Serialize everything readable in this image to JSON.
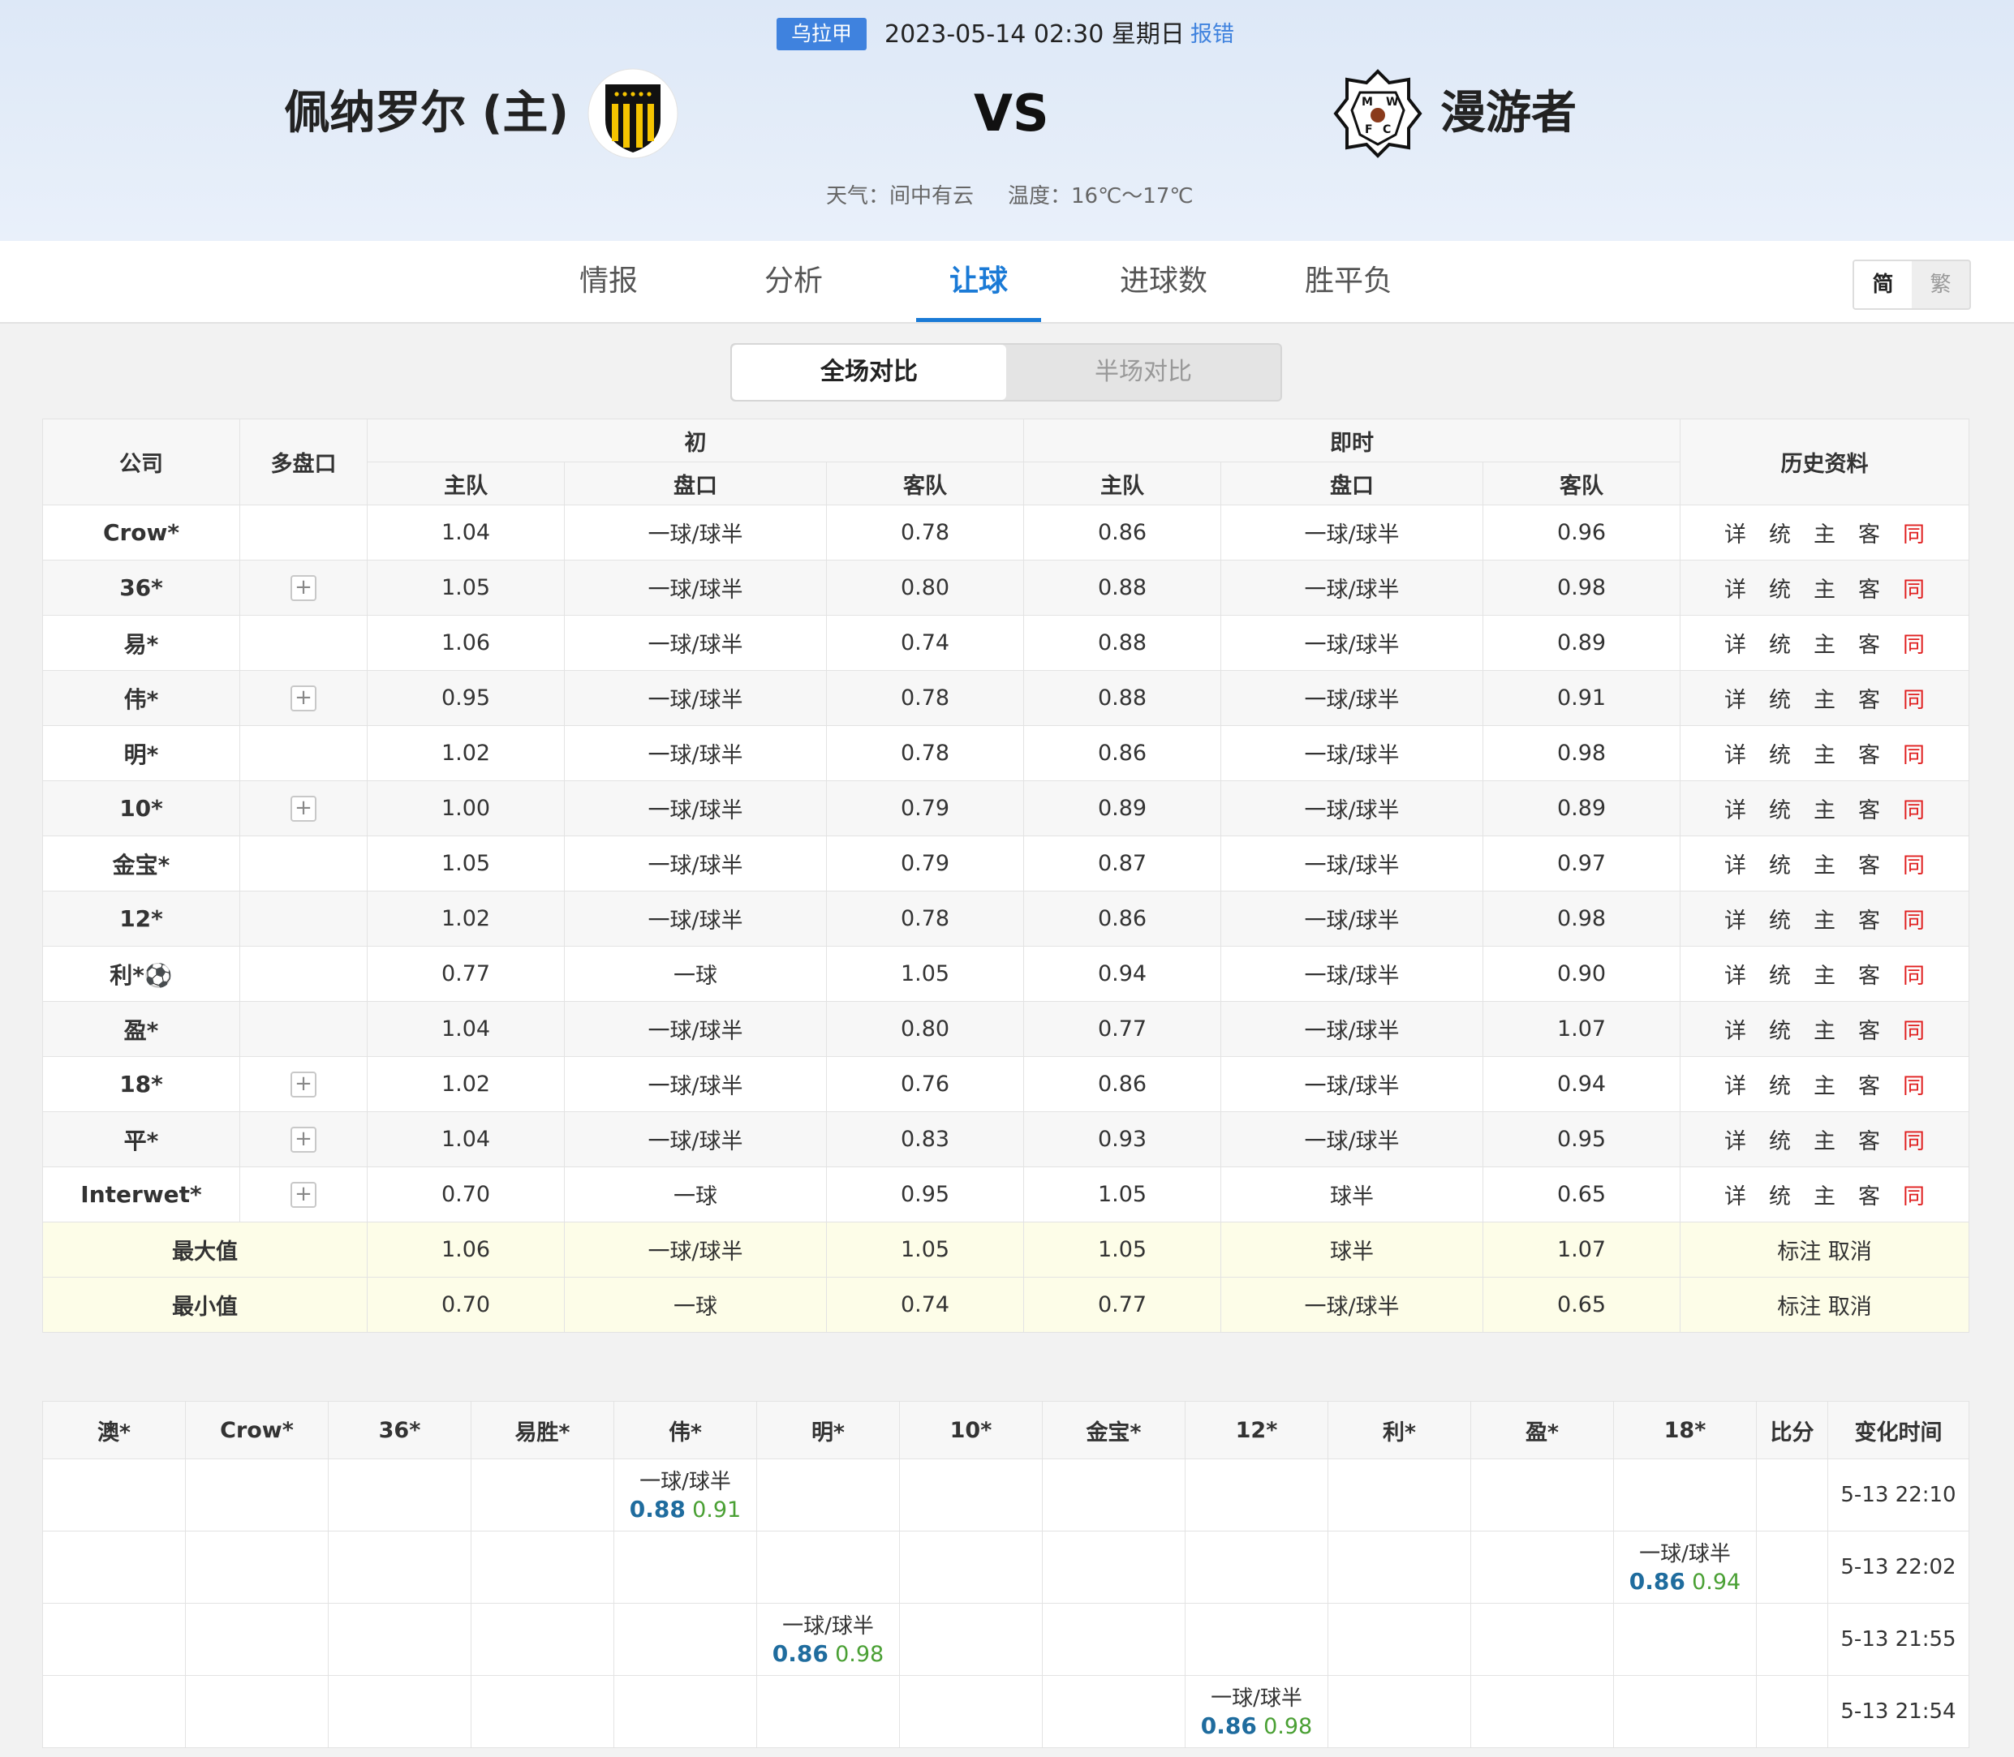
{
  "header": {
    "league": "乌拉甲",
    "datetime": "2023-05-14 02:30 星期日",
    "report": "报错",
    "home": "佩纳罗尔 (主)",
    "away": "漫游者",
    "vs": "VS",
    "weather": "天气：间中有云",
    "temperature": "温度：16℃～17℃"
  },
  "nav": {
    "tabs": [
      "情报",
      "分析",
      "让球",
      "进球数",
      "胜平负"
    ],
    "active": "让球",
    "lang_simplified": "简",
    "lang_traditional": "繁"
  },
  "segment": {
    "full": "全场对比",
    "half": "半场对比"
  },
  "odds_table": {
    "col_company": "公司",
    "col_multi": "多盘口",
    "col_initial": "初",
    "col_live": "即时",
    "col_history": "历史资料",
    "col_home": "主队",
    "col_line": "盘口",
    "col_away": "客队",
    "history_links": [
      "详",
      "统",
      "主",
      "客",
      "同"
    ],
    "rows": [
      {
        "company": "Crow*",
        "multi": false,
        "ih": "1.04",
        "il": "一球/球半",
        "ia": "0.78",
        "lh": "0.86",
        "ll": "一球/球半",
        "la": "0.96"
      },
      {
        "company": "36*",
        "multi": true,
        "ih": "1.05",
        "il": "一球/球半",
        "ia": "0.80",
        "lh": "0.88",
        "ll": "一球/球半",
        "la": "0.98"
      },
      {
        "company": "易*",
        "multi": false,
        "ih": "1.06",
        "il": "一球/球半",
        "ia": "0.74",
        "lh": "0.88",
        "ll": "一球/球半",
        "la": "0.89"
      },
      {
        "company": "伟*",
        "multi": true,
        "ih": "0.95",
        "il": "一球/球半",
        "ia": "0.78",
        "lh": "0.88",
        "ll": "一球/球半",
        "la": "0.91"
      },
      {
        "company": "明*",
        "multi": false,
        "ih": "1.02",
        "il": "一球/球半",
        "ia": "0.78",
        "lh": "0.86",
        "ll": "一球/球半",
        "la": "0.98"
      },
      {
        "company": "10*",
        "multi": true,
        "ih": "1.00",
        "il": "一球/球半",
        "ia": "0.79",
        "lh": "0.89",
        "ll": "一球/球半",
        "la": "0.89"
      },
      {
        "company": "金宝*",
        "multi": false,
        "ih": "1.05",
        "il": "一球/球半",
        "ia": "0.79",
        "lh": "0.87",
        "ll": "一球/球半",
        "la": "0.97"
      },
      {
        "company": "12*",
        "multi": false,
        "ih": "1.02",
        "il": "一球/球半",
        "ia": "0.78",
        "lh": "0.86",
        "ll": "一球/球半",
        "la": "0.98"
      },
      {
        "company": "利*⚽",
        "multi": false,
        "ih": "0.77",
        "il": "一球",
        "ia": "1.05",
        "lh": "0.94",
        "ll": "一球/球半",
        "la": "0.90"
      },
      {
        "company": "盈*",
        "multi": false,
        "ih": "1.04",
        "il": "一球/球半",
        "ia": "0.80",
        "lh": "0.77",
        "ll": "一球/球半",
        "la": "1.07"
      },
      {
        "company": "18*",
        "multi": true,
        "ih": "1.02",
        "il": "一球/球半",
        "ia": "0.76",
        "lh": "0.86",
        "ll": "一球/球半",
        "la": "0.94"
      },
      {
        "company": "平*",
        "multi": true,
        "ih": "1.04",
        "il": "一球/球半",
        "ia": "0.83",
        "lh": "0.93",
        "ll": "一球/球半",
        "la": "0.95"
      },
      {
        "company": "Interwet*",
        "multi": true,
        "ih": "0.70",
        "il": "一球",
        "ia": "0.95",
        "lh": "1.05",
        "ll": "球半",
        "la": "0.65"
      }
    ],
    "summary": [
      {
        "label": "最大值",
        "ih": "1.06",
        "il": "一球/球半",
        "ia": "1.05",
        "lh": "1.05",
        "ll": "球半",
        "la": "1.07",
        "action": "标注 取消"
      },
      {
        "label": "最小值",
        "ih": "0.70",
        "il": "一球",
        "ia": "0.74",
        "lh": "0.77",
        "ll": "一球/球半",
        "la": "0.65",
        "action": "标注 取消"
      }
    ]
  },
  "changes_table": {
    "headers": [
      "澳*",
      "Crow*",
      "36*",
      "易胜*",
      "伟*",
      "明*",
      "10*",
      "金宝*",
      "12*",
      "利*",
      "盈*",
      "18*",
      "比分",
      "变化时间"
    ],
    "rows": [
      {
        "col": 4,
        "line": "一球/球半",
        "home": "0.88",
        "away": "0.91",
        "time": "5-13 22:10"
      },
      {
        "col": 11,
        "line": "一球/球半",
        "home": "0.86",
        "away": "0.94",
        "time": "5-13 22:02"
      },
      {
        "col": 5,
        "line": "一球/球半",
        "home": "0.86",
        "away": "0.98",
        "time": "5-13 21:55"
      },
      {
        "col": 8,
        "line": "一球/球半",
        "home": "0.86",
        "away": "0.98",
        "time": "5-13 21:54"
      }
    ]
  }
}
